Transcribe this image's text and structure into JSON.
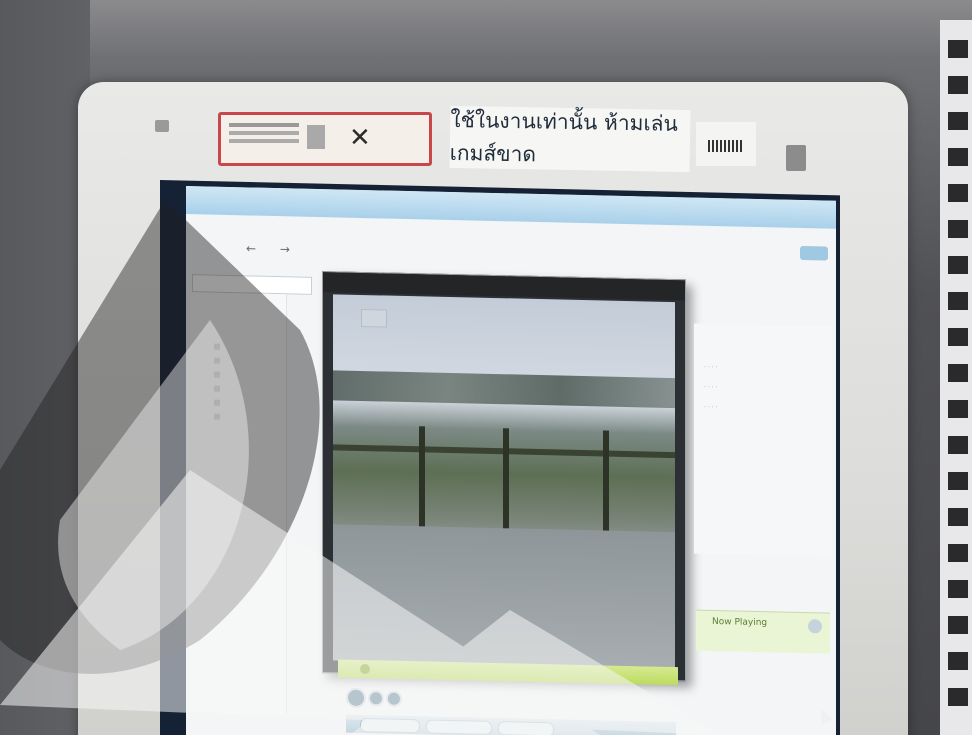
{
  "bezel": {
    "thai_notice": "ใช้ในงานเท่านั้น ห้ามเล่นเกมส์ขาด",
    "sticker_icon": "no-game-icon"
  },
  "player": {
    "now_playing_label": "Now Playing",
    "accent_color": "#b9d64e",
    "titlebar_color": "#a9d0ea"
  },
  "icons": {
    "back": "back-arrow-icon",
    "forward": "forward-arrow-icon",
    "play": "play-icon",
    "previous": "previous-icon",
    "next": "next-icon",
    "now_playing": "now-playing-icon"
  },
  "colors": {
    "sticker_border": "#c9474a",
    "rack_panel": "#e8e8ea"
  }
}
